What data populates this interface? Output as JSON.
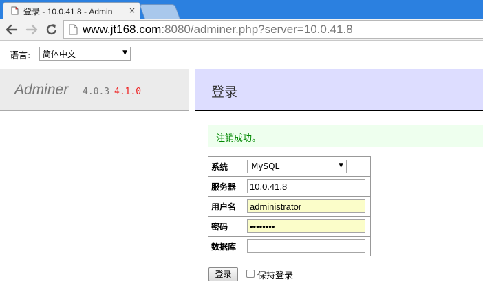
{
  "browser": {
    "tab_title": "登录 - 10.0.41.8 - Admin",
    "tab_close_glyph": "×",
    "url_host": "www.jt168.com",
    "url_rest": ":8080/adminer.php?server=10.0.41.8"
  },
  "language": {
    "label": "语言:",
    "selected": "简体中文"
  },
  "adminer": {
    "logo": "Adminer",
    "version": "4.0.3",
    "new_version": "4.1.0"
  },
  "page": {
    "title": "登录",
    "message": "注销成功。"
  },
  "login": {
    "system_label": "系统",
    "system_value": "MySQL",
    "server_label": "服务器",
    "server_value": "10.0.41.8",
    "username_label": "用户名",
    "username_value": "administrator",
    "password_label": "密码",
    "password_mask": "••••••••",
    "database_label": "数据库",
    "database_value": "",
    "submit_label": "登录",
    "remember_label": "保持登录"
  },
  "colors": {
    "tabstrip": "#2b80e0",
    "header_bg": "#ddddff",
    "message_text": "#008800",
    "new_version": "#ee2222",
    "autofill": "#fbfdc9"
  }
}
